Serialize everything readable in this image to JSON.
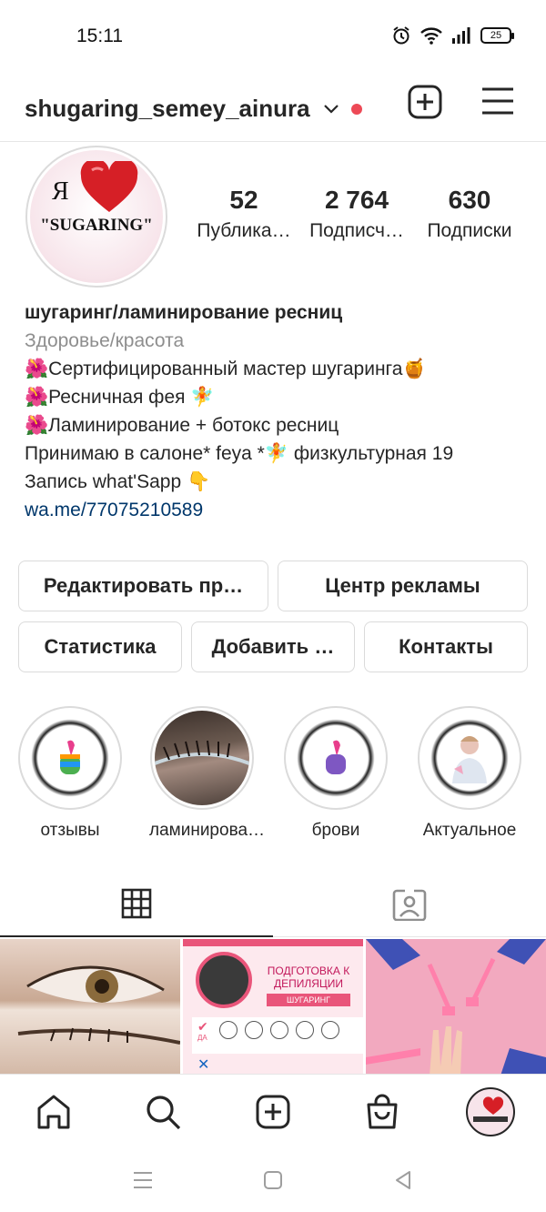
{
  "status_bar": {
    "time": "15:11",
    "battery": "25"
  },
  "header": {
    "username": "shugaring_semey_ainura"
  },
  "avatar": {
    "ya": "Я",
    "text": "\"SUGARING\""
  },
  "stats": [
    {
      "value": "52",
      "label": "Публика…"
    },
    {
      "value": "2 764",
      "label": "Подписч…"
    },
    {
      "value": "630",
      "label": "Подписки"
    }
  ],
  "bio": {
    "name": "шугаринг/ламинирование ресниц",
    "category": "Здоровье/красота",
    "lines": [
      "🌺Сертифицированный мастер шугаринга🍯",
      "🌺Ресничная фея 🧚",
      "🌺Ламинирование + ботокс ресниц",
      "Принимаю в салоне* feya *🧚 физкультурная 19",
      "Запись what'Sapp 👇"
    ],
    "link": "wa.me/77075210589"
  },
  "buttons": {
    "edit": "Редактировать пр…",
    "ads": "Центр рекламы",
    "stats": "Статистика",
    "add": "Добавить …",
    "contacts": "Контакты"
  },
  "highlights": [
    {
      "label": "отзывы",
      "icon": "heart-fingers-icon"
    },
    {
      "label": "ламинирова…",
      "icon": "lashes-photo"
    },
    {
      "label": "брови",
      "icon": "heart-fingers-icon"
    },
    {
      "label": "Актуальное",
      "icon": "person-photo"
    }
  ],
  "grid_posts": [
    {
      "label": "",
      "kind": "eye-photo"
    },
    {
      "title": "ПОДГОТОВКА К ДЕПИЛЯЦИИ",
      "subtitle": "ШУГАРИНГ",
      "yes": "ДА"
    },
    {
      "label": "",
      "kind": "hands-photo"
    }
  ],
  "colors": {
    "accent_red": "#ed4956",
    "link": "#00376b",
    "post_pink": "#e9557a"
  }
}
